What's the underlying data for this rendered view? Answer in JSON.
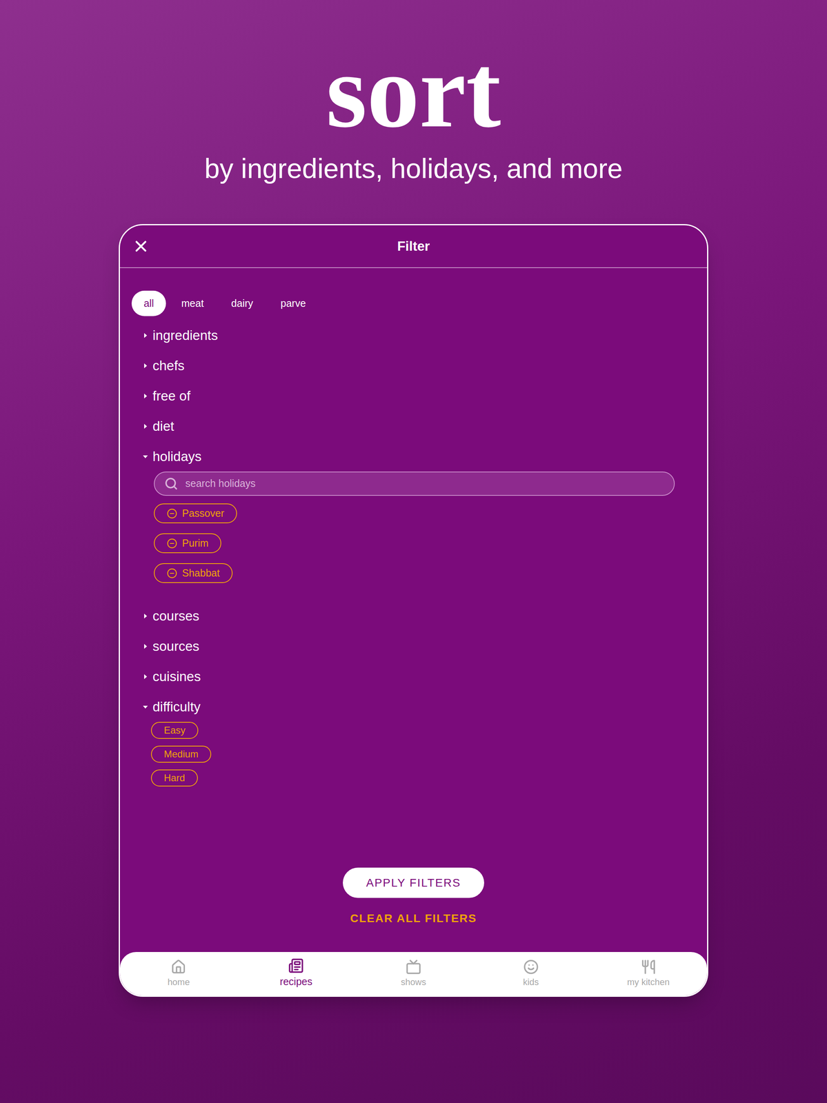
{
  "headline": "sort",
  "subtitle": "by ingredients, holidays, and more",
  "filter": {
    "title": "Filter",
    "close": true,
    "types": [
      {
        "label": "all",
        "selected": true
      },
      {
        "label": "meat",
        "selected": false
      },
      {
        "label": "dairy",
        "selected": false
      },
      {
        "label": "parve",
        "selected": false
      }
    ],
    "sections": [
      {
        "label": "ingredients",
        "expanded": false,
        "options": []
      },
      {
        "label": "chefs",
        "expanded": false,
        "options": []
      },
      {
        "label": "free of",
        "expanded": false,
        "options": []
      },
      {
        "label": "diet",
        "expanded": false,
        "options": []
      },
      {
        "label": "holidays",
        "expanded": true,
        "search": {
          "placeholder": "search holidays"
        },
        "options": [
          {
            "label": "Passover",
            "kind": "removable"
          },
          {
            "label": "Purim",
            "kind": "removable"
          },
          {
            "label": "Shabbat",
            "kind": "removable"
          }
        ]
      },
      {
        "label": "courses",
        "expanded": false,
        "options": []
      },
      {
        "label": "sources",
        "expanded": false,
        "options": []
      },
      {
        "label": "cuisines",
        "expanded": false,
        "options": []
      },
      {
        "label": "difficulty",
        "expanded": true,
        "options": [
          {
            "label": "Easy",
            "kind": "plain"
          },
          {
            "label": "Medium",
            "kind": "plain"
          },
          {
            "label": "Hard",
            "kind": "plain"
          }
        ]
      }
    ],
    "apply": "APPLY FILTERS",
    "clear": "CLEAR ALL FILTERS"
  },
  "tab_bar": [
    {
      "label": "home",
      "selected": false
    },
    {
      "label": "recipes",
      "selected": true
    },
    {
      "label": "shows",
      "selected": false
    },
    {
      "label": "kids",
      "selected": false
    },
    {
      "label": "my kitchen",
      "selected": false
    }
  ]
}
